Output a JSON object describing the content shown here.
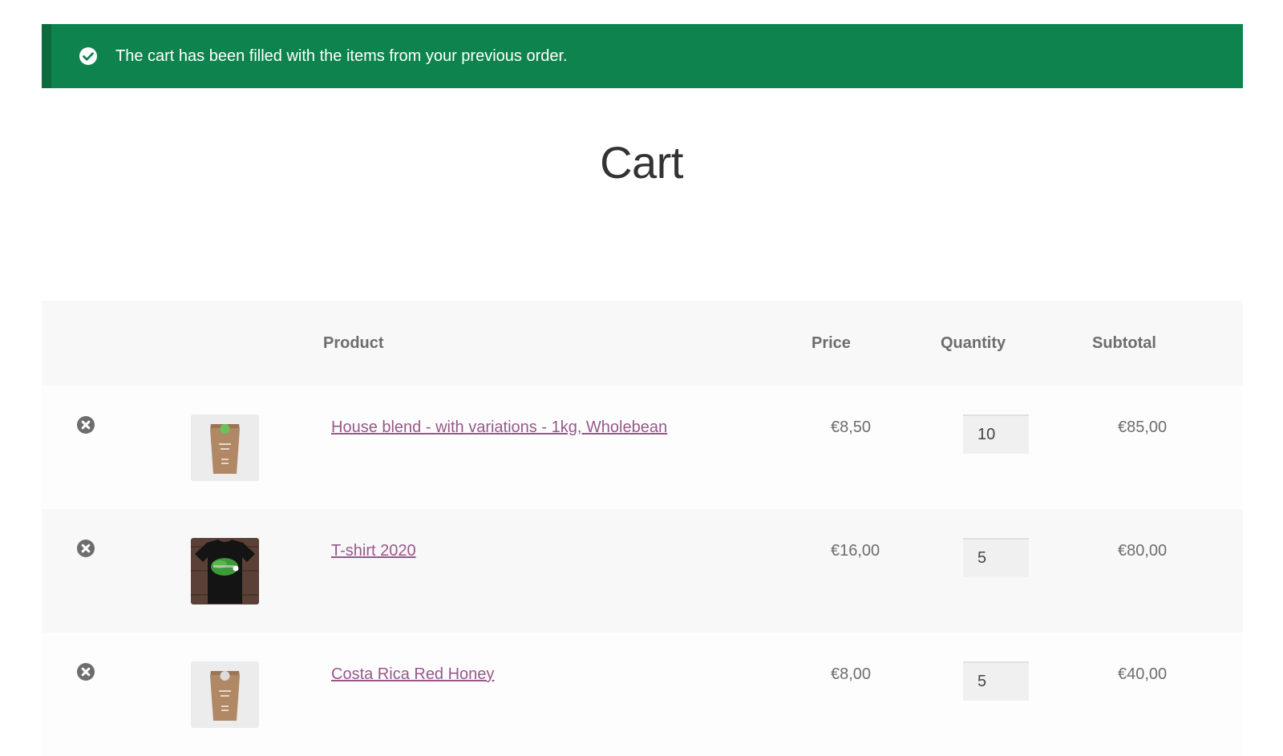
{
  "notice": {
    "message": "The cart has been filled with the items from your previous order.",
    "icon": "check-circle-icon",
    "bg_color": "#0f834d"
  },
  "page": {
    "title": "Cart"
  },
  "table": {
    "headers": {
      "product": "Product",
      "price": "Price",
      "quantity": "Quantity",
      "subtotal": "Subtotal"
    },
    "rows": [
      {
        "product": "House blend - with variations - 1kg, Wholebean",
        "price": "€8,50",
        "quantity": "10",
        "subtotal": "€85,00",
        "thumbnail": "coffee-bag-image"
      },
      {
        "product": "T-shirt 2020",
        "price": "€16,00",
        "quantity": "5",
        "subtotal": "€80,00",
        "thumbnail": "tshirt-image"
      },
      {
        "product": "Costa Rica Red Honey",
        "price": "€8,00",
        "quantity": "5",
        "subtotal": "€40,00",
        "thumbnail": "coffee-bag-image"
      }
    ]
  },
  "colors": {
    "link": "#96588a",
    "text_muted": "#6d6d6d",
    "row_alt": "#f8f8f8"
  }
}
